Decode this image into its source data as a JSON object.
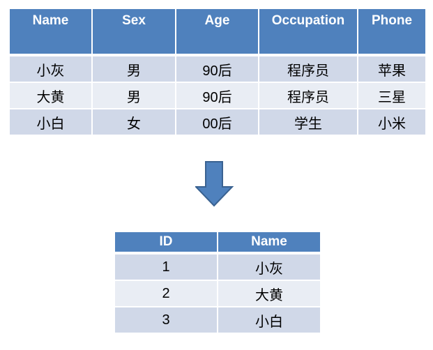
{
  "source_table": {
    "headers": [
      "Name",
      "Sex",
      "Age",
      "Occupation",
      "Phone"
    ],
    "rows": [
      [
        "小灰",
        "男",
        "90后",
        "程序员",
        "苹果"
      ],
      [
        "大黄",
        "男",
        "90后",
        "程序员",
        "三星"
      ],
      [
        "小白",
        "女",
        "00后",
        "学生",
        "小米"
      ]
    ]
  },
  "result_table": {
    "headers": [
      "ID",
      "Name"
    ],
    "rows": [
      [
        "1",
        "小灰"
      ],
      [
        "2",
        "大黄"
      ],
      [
        "3",
        "小白"
      ]
    ]
  },
  "colors": {
    "header": "#4f81bd",
    "row_odd": "#d0d8e8",
    "row_even": "#e9edf4",
    "arrow": "#4f81bd"
  },
  "arrow_icon": "down-arrow-icon"
}
